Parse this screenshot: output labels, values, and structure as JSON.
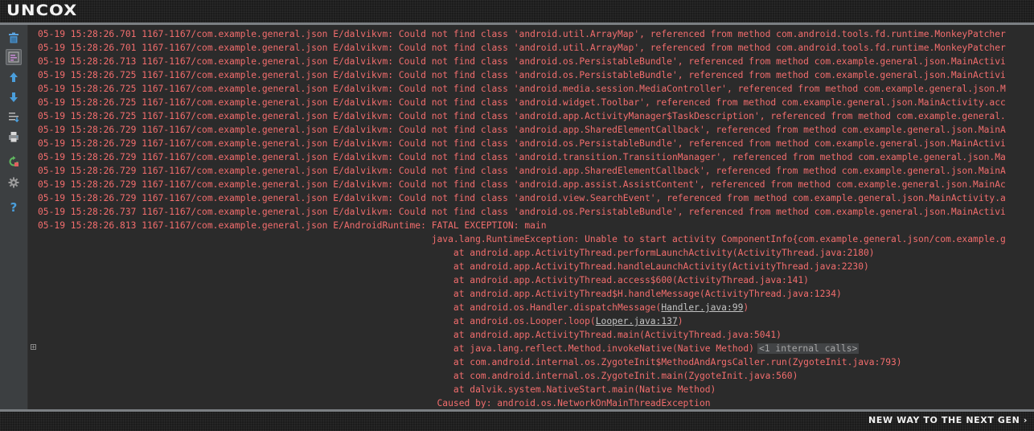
{
  "brand": {
    "logo_text": "UNCOX",
    "tagline": "NEW WAY TO THE NEXT GEN ›"
  },
  "colors": {
    "log_error": "#f26d6d",
    "toolbar_bg": "#3c3f41",
    "console_bg": "#2b2b2b",
    "icon_blue": "#4a9edb"
  },
  "toolbar": {
    "buttons": [
      {
        "icon": "trash-icon"
      },
      {
        "icon": "soft-wrap-icon",
        "active": true
      },
      {
        "icon": "arrow-up-icon"
      },
      {
        "icon": "arrow-down-icon"
      },
      {
        "icon": "scroll-to-end-icon"
      },
      {
        "icon": "print-icon"
      },
      {
        "icon": "restart-icon"
      },
      {
        "icon": "gear-icon"
      },
      {
        "icon": "help-icon"
      }
    ]
  },
  "log": {
    "lines": [
      {
        "text": "05-19 15:28:26.701 1167-1167/com.example.general.json E/dalvikvm: Could not find class 'android.util.ArrayMap', referenced from method com.android.tools.fd.runtime.MonkeyPatcher"
      },
      {
        "text": "05-19 15:28:26.701 1167-1167/com.example.general.json E/dalvikvm: Could not find class 'android.util.ArrayMap', referenced from method com.android.tools.fd.runtime.MonkeyPatcher"
      },
      {
        "text": "05-19 15:28:26.713 1167-1167/com.example.general.json E/dalvikvm: Could not find class 'android.os.PersistableBundle', referenced from method com.example.general.json.MainActivi"
      },
      {
        "text": "05-19 15:28:26.725 1167-1167/com.example.general.json E/dalvikvm: Could not find class 'android.os.PersistableBundle', referenced from method com.example.general.json.MainActivi"
      },
      {
        "text": "05-19 15:28:26.725 1167-1167/com.example.general.json E/dalvikvm: Could not find class 'android.media.session.MediaController', referenced from method com.example.general.json.M"
      },
      {
        "text": "05-19 15:28:26.725 1167-1167/com.example.general.json E/dalvikvm: Could not find class 'android.widget.Toolbar', referenced from method com.example.general.json.MainActivity.acc"
      },
      {
        "text": "05-19 15:28:26.725 1167-1167/com.example.general.json E/dalvikvm: Could not find class 'android.app.ActivityManager$TaskDescription', referenced from method com.example.general."
      },
      {
        "text": "05-19 15:28:26.729 1167-1167/com.example.general.json E/dalvikvm: Could not find class 'android.app.SharedElementCallback', referenced from method com.example.general.json.MainA"
      },
      {
        "text": "05-19 15:28:26.729 1167-1167/com.example.general.json E/dalvikvm: Could not find class 'android.os.PersistableBundle', referenced from method com.example.general.json.MainActivi"
      },
      {
        "text": "05-19 15:28:26.729 1167-1167/com.example.general.json E/dalvikvm: Could not find class 'android.transition.TransitionManager', referenced from method com.example.general.json.Ma"
      },
      {
        "text": "05-19 15:28:26.729 1167-1167/com.example.general.json E/dalvikvm: Could not find class 'android.app.SharedElementCallback', referenced from method com.example.general.json.MainA"
      },
      {
        "text": "05-19 15:28:26.729 1167-1167/com.example.general.json E/dalvikvm: Could not find class 'android.app.assist.AssistContent', referenced from method com.example.general.json.MainAc"
      },
      {
        "text": "05-19 15:28:26.729 1167-1167/com.example.general.json E/dalvikvm: Could not find class 'android.view.SearchEvent', referenced from method com.example.general.json.MainActivity.a"
      },
      {
        "text": "05-19 15:28:26.737 1167-1167/com.example.general.json E/dalvikvm: Could not find class 'android.os.PersistableBundle', referenced from method com.example.general.json.MainActivi"
      },
      {
        "text": "05-19 15:28:26.813 1167-1167/com.example.general.json E/AndroidRuntime: FATAL EXCEPTION: main"
      },
      {
        "text": "                                                                        java.lang.RuntimeException: Unable to start activity ComponentInfo{com.example.general.json/com.example.g"
      },
      {
        "text": "                                                                            at android.app.ActivityThread.performLaunchActivity(ActivityThread.java:2180)"
      },
      {
        "text": "                                                                            at android.app.ActivityThread.handleLaunchActivity(ActivityThread.java:2230)"
      },
      {
        "text": "                                                                            at android.app.ActivityThread.access$600(ActivityThread.java:141)"
      },
      {
        "text": "                                                                            at android.app.ActivityThread$H.handleMessage(ActivityThread.java:1234)"
      },
      {
        "text": "                                                                            at android.os.Handler.dispatchMessage(",
        "link": "Handler.java:99",
        "suffix": ")"
      },
      {
        "text": "                                                                            at android.os.Looper.loop(",
        "link": "Looper.java:137",
        "suffix": ")"
      },
      {
        "text": "                                                                            at android.app.ActivityThread.main(ActivityThread.java:5041)"
      },
      {
        "text": "                                                                            at java.lang.reflect.Method.invokeNative(Native Method)",
        "badge": "<1 internal calls>"
      },
      {
        "text": "                                                                            at com.android.internal.os.ZygoteInit$MethodAndArgsCaller.run(ZygoteInit.java:793)"
      },
      {
        "text": "                                                                            at com.android.internal.os.ZygoteInit.main(ZygoteInit.java:560)"
      },
      {
        "text": "                                                                            at dalvik.system.NativeStart.main(Native Method)"
      },
      {
        "text": "                                                                         Caused by: android.os.NetworkOnMainThreadException"
      }
    ]
  }
}
